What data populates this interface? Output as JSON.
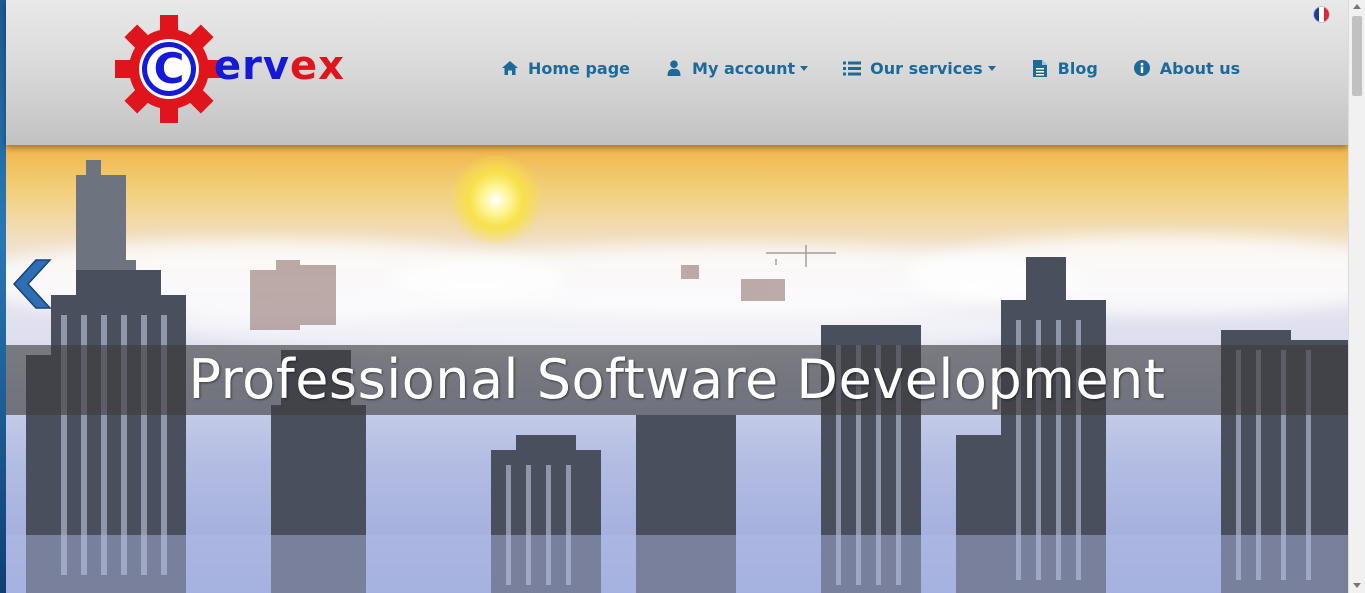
{
  "logo": {
    "letter": "C",
    "word_blue": "erv",
    "word_red": "ex",
    "brand_blue": "#1519d8",
    "brand_red": "#e0141d"
  },
  "nav": {
    "items": [
      {
        "label": "Home page",
        "icon": "home-icon"
      },
      {
        "label": "My account",
        "icon": "user-icon",
        "dropdown": true
      },
      {
        "label": "Our services",
        "icon": "list-icon",
        "dropdown": true
      },
      {
        "label": "Blog",
        "icon": "document-icon"
      },
      {
        "label": "About us",
        "icon": "info-icon"
      }
    ],
    "color": "#1d6a9a"
  },
  "language": {
    "icon": "french-flag-icon"
  },
  "hero": {
    "caption": "Professional Software Development",
    "prev_icon": "chevron-left-icon"
  }
}
